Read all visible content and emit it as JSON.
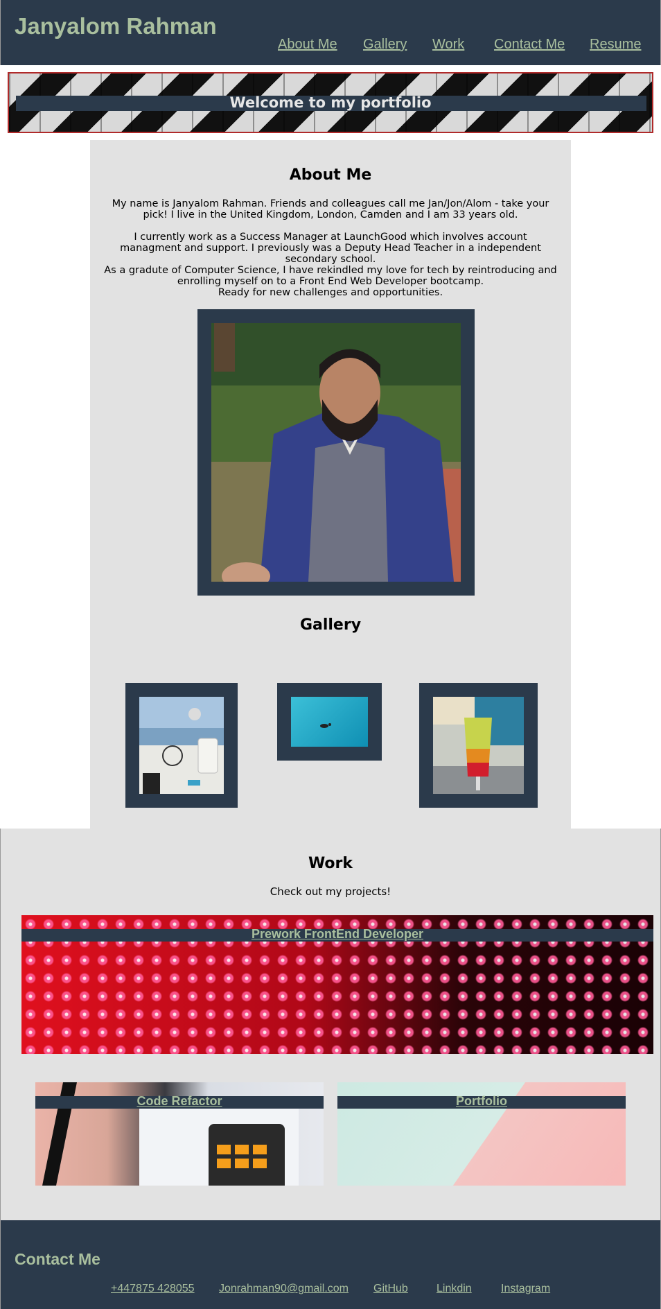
{
  "header": {
    "site_name": "Janyalom Rahman",
    "nav": [
      "About Me",
      "Gallery",
      "Work",
      "Contact Me",
      "Resume"
    ]
  },
  "hero": {
    "title": "Welcome to my portfolio"
  },
  "about": {
    "heading": "About Me",
    "p1": "My name is Janyalom Rahman. Friends and colleagues call me Jan/Jon/Alom - take your pick! I live in the United Kingdom, London, Camden and I am 33 years old.",
    "p2": "I currently work as a Success Manager at LaunchGood which involves account managment and support. I previously was a Deputy Head Teacher in a independent secondary school.",
    "p3a": "As a gradute of Computer Science, I have rekindled my love for tech by reintroducing and enrolling myself on to a Front End Web Developer bootcamp.",
    "p3b": "Ready for new challenges and opportunities."
  },
  "gallery": {
    "heading": "Gallery"
  },
  "work": {
    "heading": "Work",
    "subtitle": "Check out my projects!",
    "projects": [
      "Prework FrontEnd Developer",
      "Code Refactor",
      "Portfolio"
    ]
  },
  "footer": {
    "heading": "Contact Me",
    "links": [
      "+447875 428055",
      "Jonrahman90@gmail.com",
      "GitHub",
      "Linkdin",
      "Instagram"
    ]
  },
  "colors": {
    "navy": "#2b3a4b",
    "sage": "#a9bf9e",
    "panel": "#e2e2e2",
    "hero_border": "#b02a2a"
  }
}
